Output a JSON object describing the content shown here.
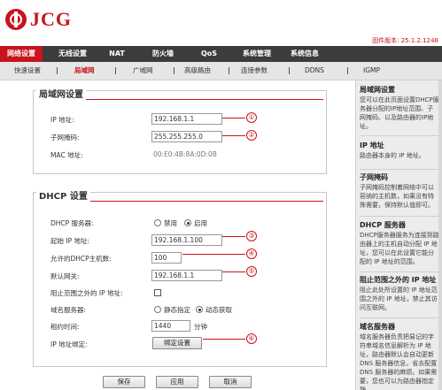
{
  "brand": {
    "logo_text": "JCG"
  },
  "firmware": "固件版本: 25.1.2.1248",
  "nav": [
    "网络设置",
    "无线设置",
    "NAT",
    "防火墙",
    "QoS",
    "系统管理",
    "系统信息"
  ],
  "subnav": [
    "快速设置",
    "局域网",
    "广域网",
    "高级路由",
    "连接参数",
    "DDNS",
    "IGMP"
  ],
  "lan": {
    "title": "局域网设置",
    "ip_label": "IP 地址:",
    "ip_value": "192.168.1.1",
    "mask_label": "子网掩码:",
    "mask_value": "255.255.255.0",
    "mac_label": "MAC 地址:",
    "mac_value": "00:E0:4B:8A:0D:0B"
  },
  "dhcp": {
    "title": "DHCP 设置",
    "server_label": "DHCP 服务器:",
    "disable_label": "禁用",
    "enable_label": "启用",
    "start_label": "起始 IP 地址:",
    "start_value": "192.168.1.100",
    "max_label": "允许的DHCP主机数:",
    "max_value": "100",
    "gateway_label": "默认网关:",
    "gateway_value": "192.168.1.1",
    "block_label": "阻止范围之外的 IP 地址:",
    "dns_label": "域名服务器:",
    "dns_static": "静态指定",
    "dns_dynamic": "动态获取",
    "lease_label": "租约时间:",
    "lease_value": "1440",
    "lease_unit": "分钟",
    "bind_label": "IP 地址绑定:",
    "bind_button": "绑定设置"
  },
  "callouts": [
    "①",
    "②",
    "③",
    "④",
    "⑤",
    "⑥"
  ],
  "buttons": {
    "save": "保存",
    "apply": "应用",
    "cancel": "取消"
  },
  "help": [
    {
      "title": "局域网设置",
      "text": "您可以在此页面设置DHCP服务器分配的IP地址范围、子网掩码、以及路由器的IP地址。"
    },
    {
      "title": "IP 地址",
      "text": "路由器本身的 IP 地址。"
    },
    {
      "title": "子网掩码",
      "text": "子网掩码控制着网络中可以容纳的主机数，如果没有特殊需要，保持默认值即可。"
    },
    {
      "title": "DHCP 服务器",
      "text": "DHCP服务器服务为连接到路由器上的主机自动分配 IP 地址，您可以在此设置它能分配的 IP 地址的范围。"
    },
    {
      "title": "阻止范围之外的 IP 地址",
      "text": "阻止此处所设置的 IP 地址范围之外的 IP 地址，禁止其访问互联网。"
    },
    {
      "title": "域名服务器",
      "text": "域名服务器负责把易记的字符串域名信息解析为 IP 地址，路由器默认会自动更新 DNS 服务器信息，省去配置 DNS 服务器的麻烦。如果需要，您也可以为路由器指定静"
    }
  ],
  "colors": {
    "accent": "#c8141c",
    "nav_bg": "#3c3c3c",
    "sidebar_bg": "#ececec"
  }
}
